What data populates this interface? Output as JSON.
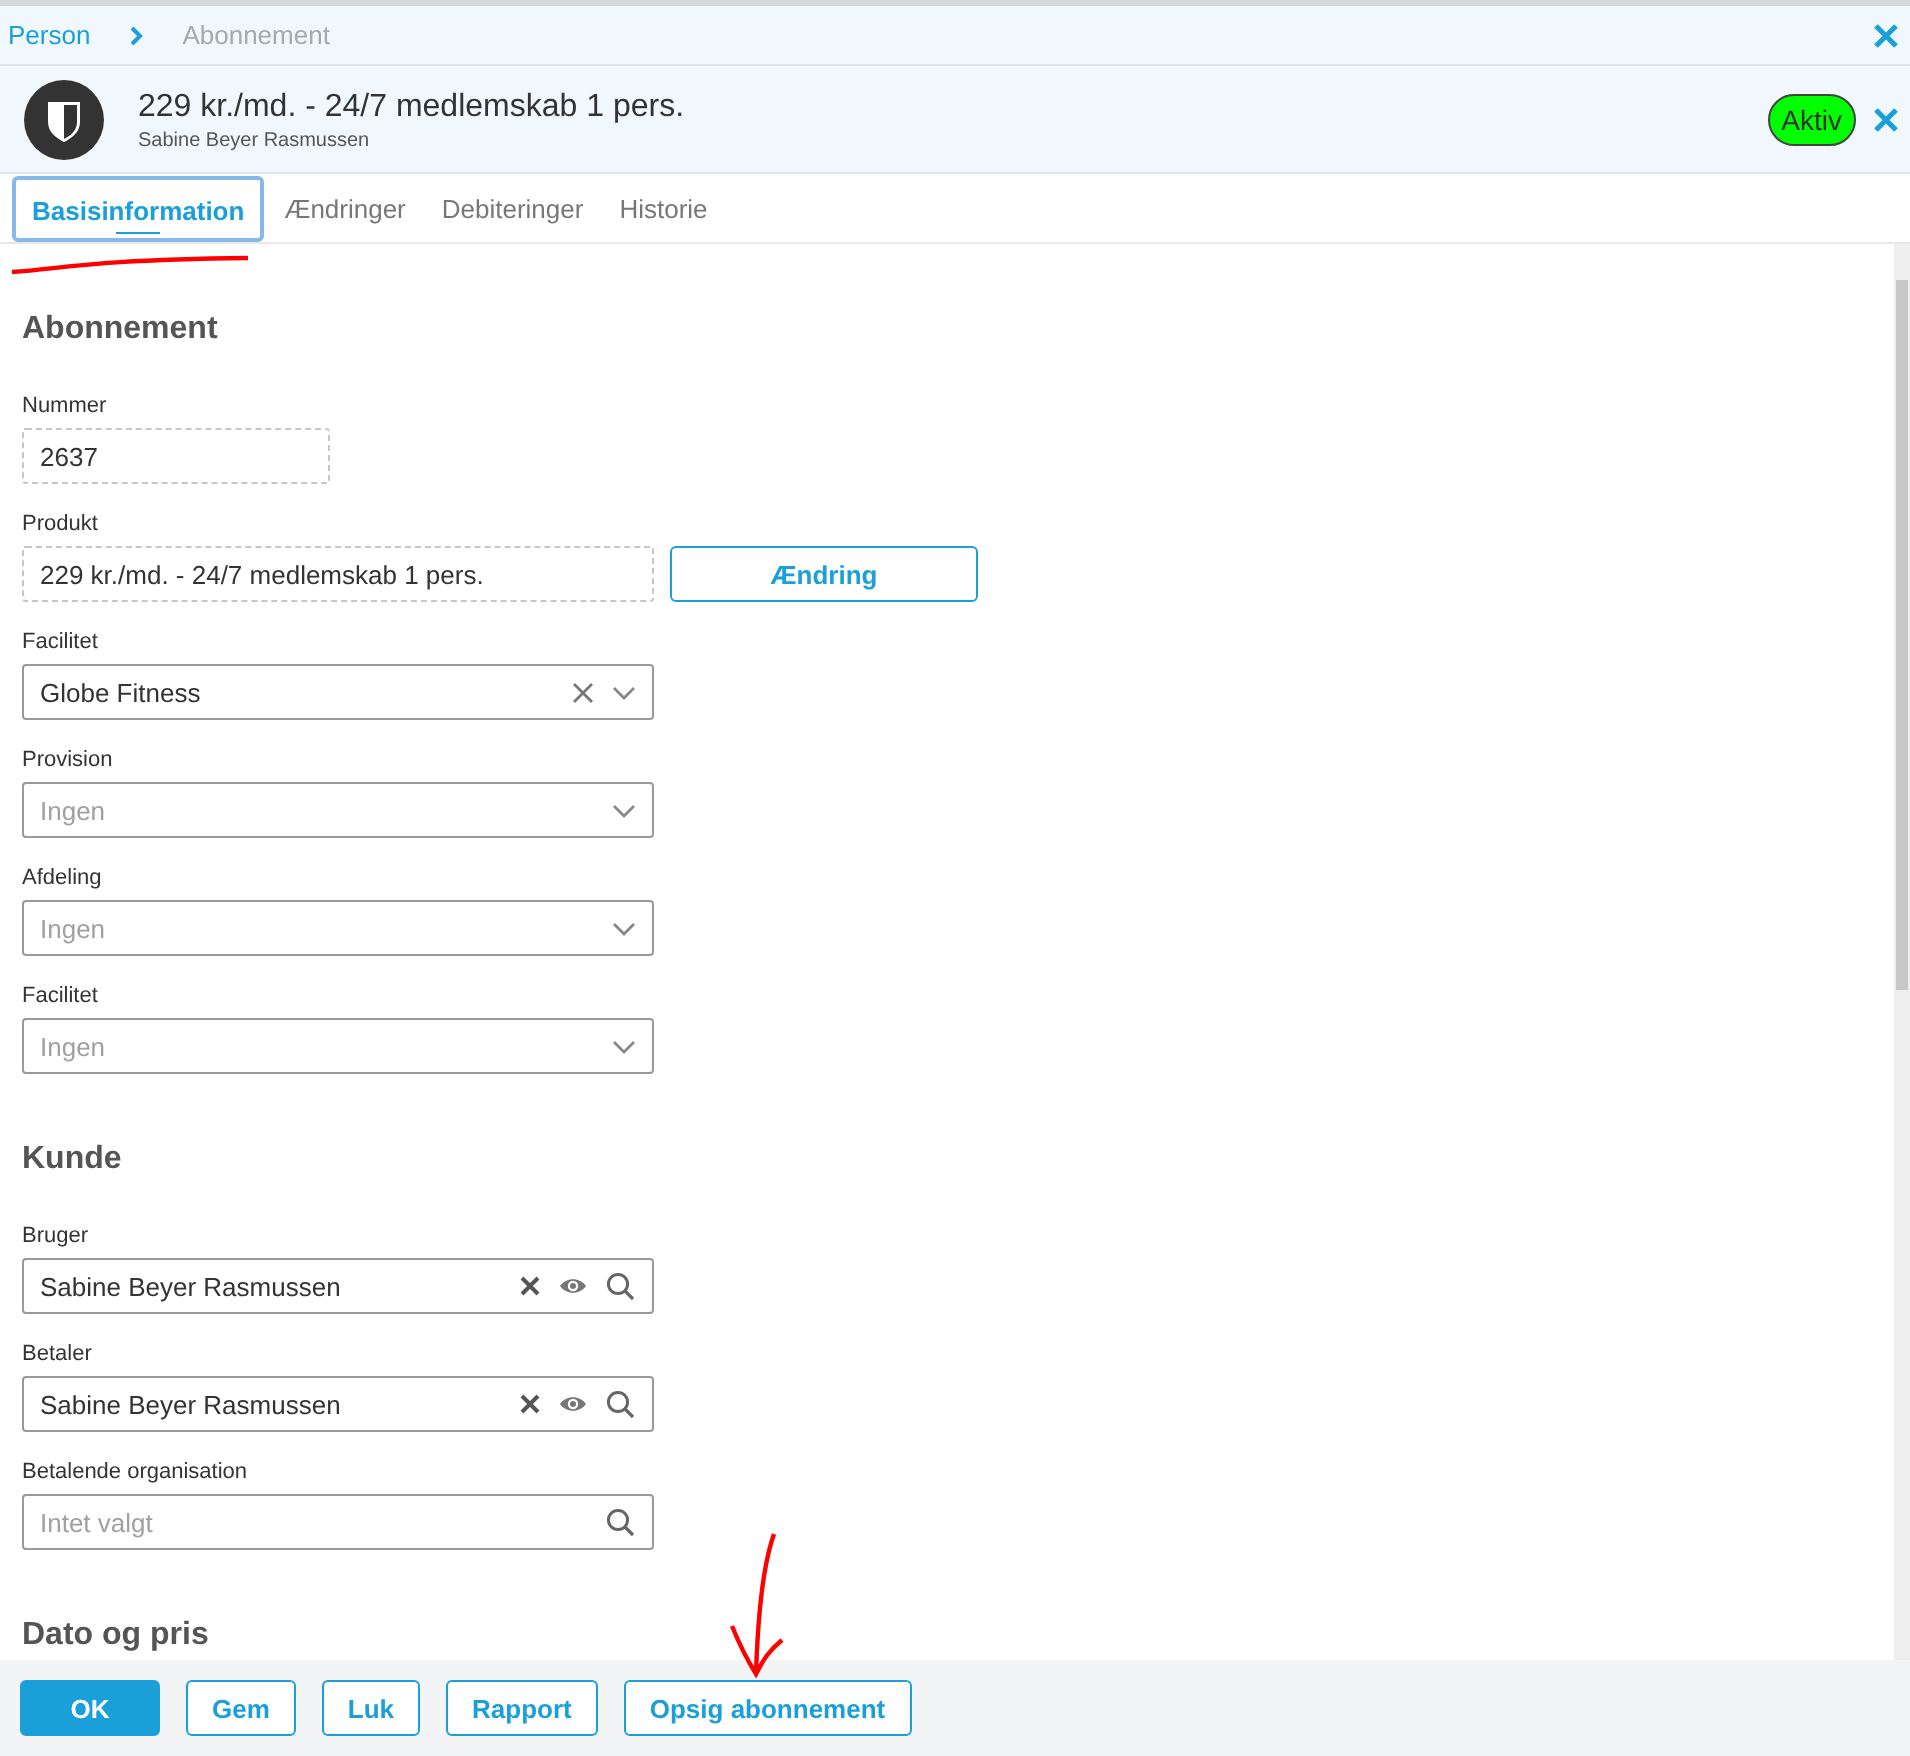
{
  "breadcrumb": [
    {
      "label": "Person",
      "current": false
    },
    {
      "label": "Abonnement",
      "current": true
    }
  ],
  "header": {
    "title": "229 kr./md. - 24/7 medlemskab 1 pers.",
    "subtitle": "Sabine Beyer Rasmussen",
    "status": "Aktiv"
  },
  "tabs": [
    {
      "label": "Basisinformation",
      "selected": true
    },
    {
      "label": "Ændringer",
      "selected": false
    },
    {
      "label": "Debiteringer",
      "selected": false
    },
    {
      "label": "Historie",
      "selected": false
    }
  ],
  "sections": [
    {
      "title": "Abonnement",
      "fields": [
        {
          "label": "Nummer",
          "kind": "readonly",
          "value": "2637"
        },
        {
          "label": "Produkt",
          "kind": "readonly",
          "value": "229 kr./md. - 24/7 medlemskab 1 pers.",
          "action": "Ændring"
        },
        {
          "label": "Facilitet",
          "kind": "select",
          "value": "Globe Fitness",
          "clearable": true
        },
        {
          "label": "Provision",
          "kind": "select",
          "placeholder": "Ingen",
          "clearable": false
        },
        {
          "label": "Afdeling",
          "kind": "select",
          "placeholder": "Ingen",
          "clearable": false
        },
        {
          "label": "Facilitet",
          "kind": "select",
          "placeholder": "Ingen",
          "clearable": false
        }
      ]
    },
    {
      "title": "Kunde",
      "fields": [
        {
          "label": "Bruger",
          "kind": "lookup",
          "value": "Sabine Beyer Rasmussen",
          "clearable": true,
          "viewable": true
        },
        {
          "label": "Betaler",
          "kind": "lookup",
          "value": "Sabine Beyer Rasmussen",
          "clearable": true,
          "viewable": true
        },
        {
          "label": "Betalende organisation",
          "kind": "lookup",
          "placeholder": "Intet valgt",
          "clearable": false,
          "viewable": false
        }
      ]
    },
    {
      "title": "Dato og pris"
    }
  ],
  "footer_buttons": [
    {
      "label": "OK",
      "primary": true
    },
    {
      "label": "Gem",
      "primary": false
    },
    {
      "label": "Luk",
      "primary": false
    },
    {
      "label": "Rapport",
      "primary": false
    },
    {
      "label": "Opsig abonnement",
      "primary": false
    }
  ]
}
